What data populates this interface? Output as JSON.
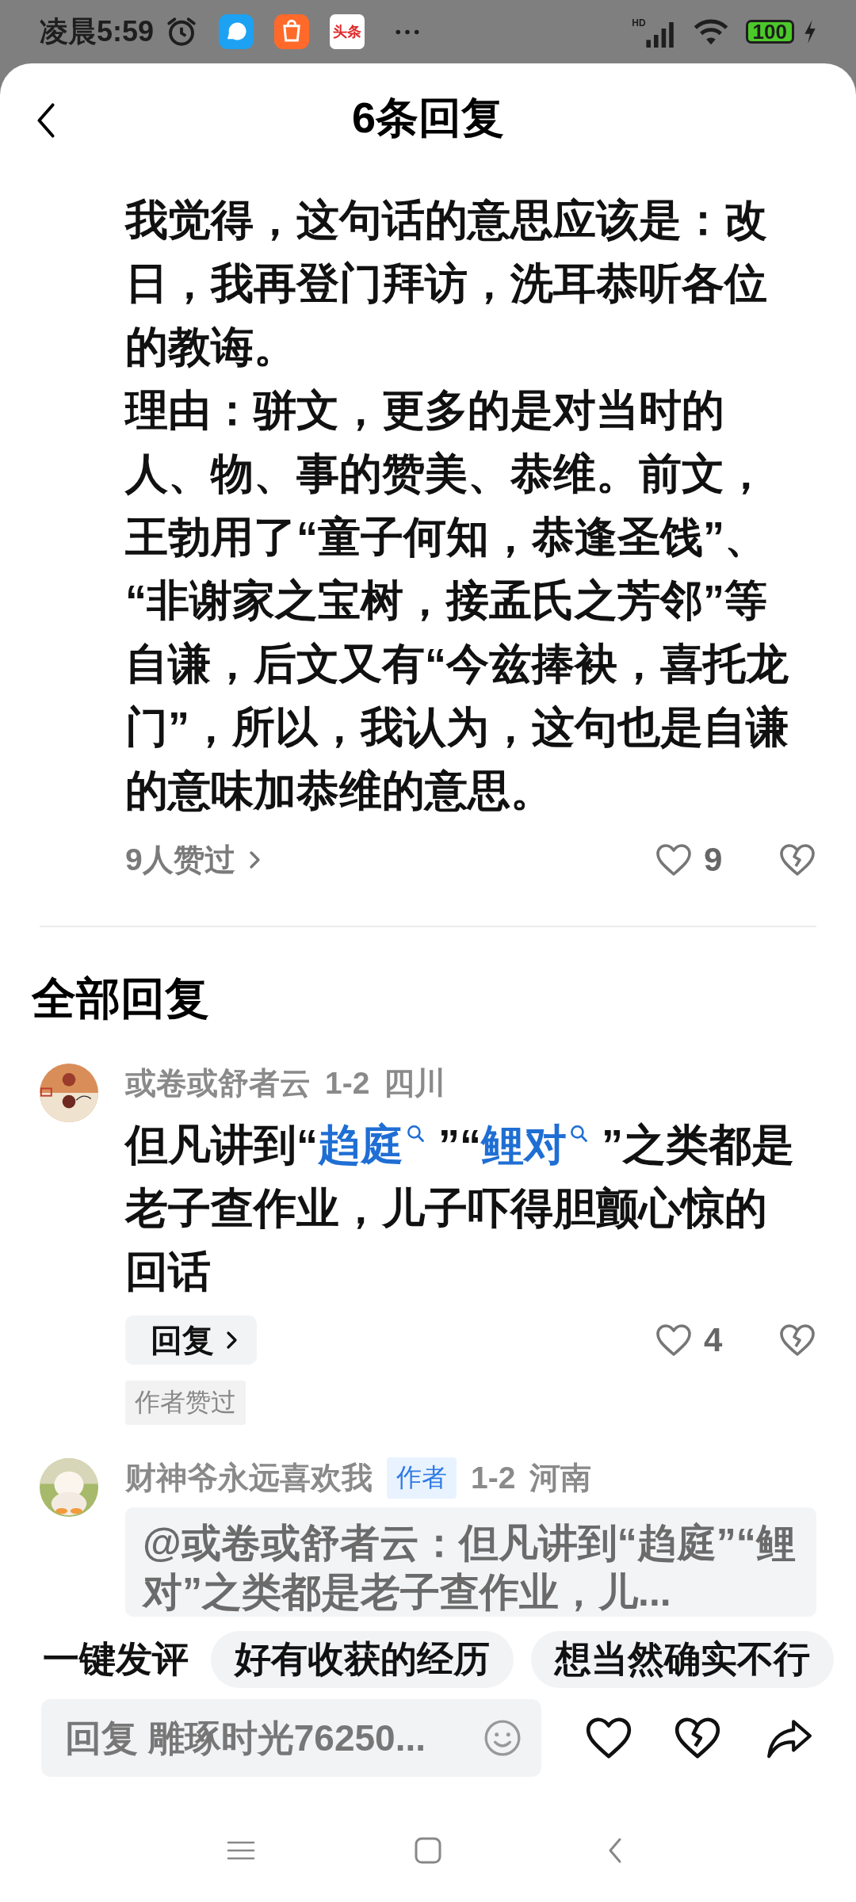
{
  "status_bar": {
    "time": "凌晨5:59",
    "apps": [
      {
        "kind": "chat"
      },
      {
        "kind": "shop"
      },
      {
        "kind": "news",
        "label": "头条"
      }
    ],
    "network": "HD",
    "battery": "100",
    "charging": true
  },
  "header": {
    "title": "6条回复"
  },
  "main_comment": {
    "lines": [
      "我觉得，这句话的意思应该是：改",
      "日，我再登门拜访，洗耳恭听各位",
      "的教诲。",
      "理由：骈文，更多的是对当时的",
      "人、物、事的赞美、恭维。前文，",
      "王勃用了“童子何知，恭逢圣饯”、",
      "“非谢家之宝树，接孟氏之芳邻”等",
      "自谦，后文又有“今兹捧袂，喜托龙",
      "门”，所以，我认为，这句也是自谦",
      "的意味加恭维的意思。"
    ],
    "likers": "9人赞过",
    "likes": "9"
  },
  "section_title": "全部回复",
  "replies": [
    {
      "name": "或卷或舒者云",
      "date": "1-2",
      "region": "四川",
      "lines": [
        [
          {
            "text": "但凡讲到“"
          },
          {
            "text": "趋庭",
            "link": true
          },
          {
            "text": "”“"
          },
          {
            "text": "鲤对",
            "link": true
          },
          {
            "text": "”之类都是"
          }
        ],
        [
          {
            "text": "老子查作业，儿子吓得胆颤心惊的"
          }
        ],
        [
          {
            "text": "回话"
          }
        ]
      ],
      "reply_button": "回复",
      "likes": "4",
      "author_liked": "作者赞过"
    },
    {
      "name": "财神爷永远喜欢我",
      "badge": "作者",
      "date": "1-2",
      "region": "河南",
      "quote_lines": [
        "@或卷或舒者云：但凡讲到“趋庭”“鲤",
        "对”之类都是老子查作业，儿..."
      ]
    }
  ],
  "quick_comments": {
    "label": "一键发评",
    "chips": [
      "好有收获的经历",
      "想当然确实不行"
    ]
  },
  "reply_field": {
    "placeholder": "回复 雕琢时光76250..."
  }
}
